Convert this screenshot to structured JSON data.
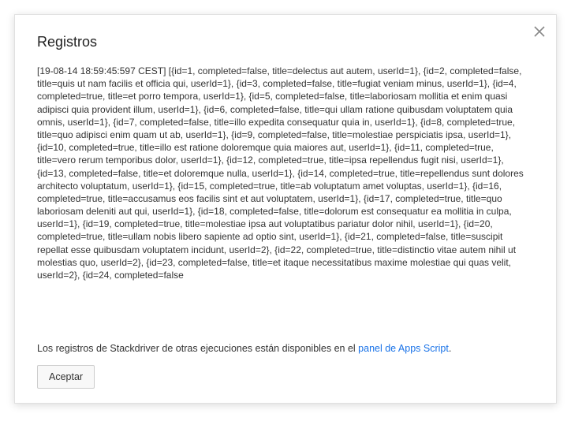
{
  "dialog": {
    "title": "Registros",
    "log_prefix": "[19-08-14 18:59:45:597 CEST] ",
    "log_entries": [
      "{id=1, completed=false, title=delectus aut autem, userId=1}",
      "{id=2, completed=false, title=quis ut nam facilis et officia qui, userId=1}",
      "{id=3, completed=false, title=fugiat veniam minus, userId=1}",
      "{id=4, completed=true, title=et porro tempora, userId=1}",
      "{id=5, completed=false, title=laboriosam mollitia et enim quasi adipisci quia provident illum, userId=1}",
      "{id=6, completed=false, title=qui ullam ratione quibusdam voluptatem quia omnis, userId=1}",
      "{id=7, completed=false, title=illo expedita consequatur quia in, userId=1}",
      "{id=8, completed=true, title=quo adipisci enim quam ut ab, userId=1}",
      "{id=9, completed=false, title=molestiae perspiciatis ipsa, userId=1}",
      "{id=10, completed=true, title=illo est ratione doloremque quia maiores aut, userId=1}",
      "{id=11, completed=true, title=vero rerum temporibus dolor, userId=1}",
      "{id=12, completed=true, title=ipsa repellendus fugit nisi, userId=1}",
      "{id=13, completed=false, title=et doloremque nulla, userId=1}",
      "{id=14, completed=true, title=repellendus sunt dolores architecto voluptatum, userId=1}",
      "{id=15, completed=true, title=ab voluptatum amet voluptas, userId=1}",
      "{id=16, completed=true, title=accusamus eos facilis sint et aut voluptatem, userId=1}",
      "{id=17, completed=true, title=quo laboriosam deleniti aut qui, userId=1}",
      "{id=18, completed=false, title=dolorum est consequatur ea mollitia in culpa, userId=1}",
      "{id=19, completed=true, title=molestiae ipsa aut voluptatibus pariatur dolor nihil, userId=1}",
      "{id=20, completed=true, title=ullam nobis libero sapiente ad optio sint, userId=1}",
      "{id=21, completed=false, title=suscipit repellat esse quibusdam voluptatem incidunt, userId=2}",
      "{id=22, completed=true, title=distinctio vitae autem nihil ut molestias quo, userId=2}",
      "{id=23, completed=false, title=et itaque necessitatibus maxime molestiae qui quas velit, userId=2}",
      "{id=24, completed=false"
    ],
    "footer_text": "Los registros de Stackdriver de otras ejecuciones están disponibles en el ",
    "footer_link": "panel de Apps Script",
    "footer_suffix": ".",
    "accept_label": "Aceptar"
  }
}
